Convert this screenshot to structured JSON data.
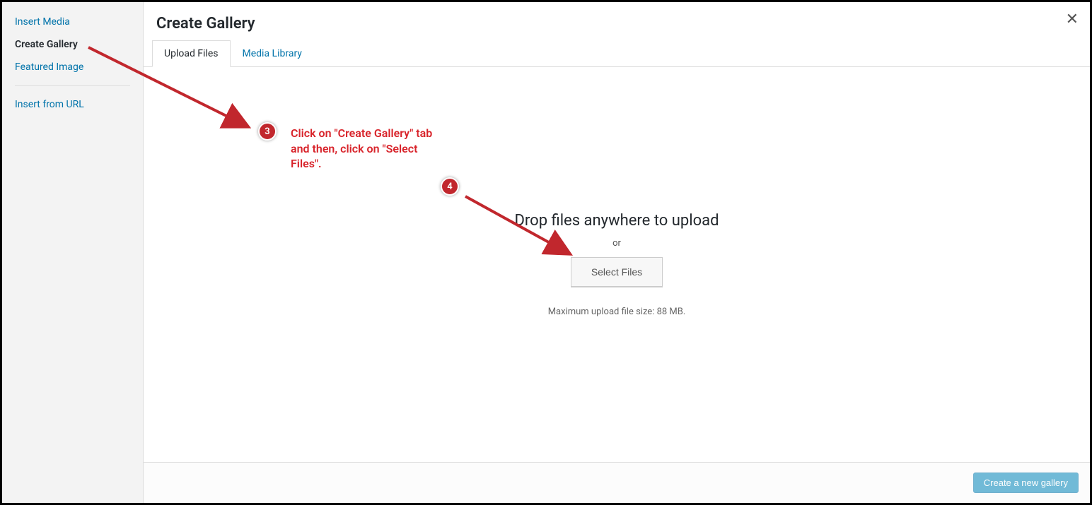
{
  "sidebar": {
    "items": [
      {
        "label": "Insert Media"
      },
      {
        "label": "Create Gallery"
      },
      {
        "label": "Featured Image"
      },
      {
        "label": "Insert from URL"
      }
    ]
  },
  "header": {
    "title": "Create Gallery"
  },
  "tabs": {
    "upload": "Upload Files",
    "library": "Media Library"
  },
  "drop": {
    "title": "Drop files anywhere to upload",
    "or": "or",
    "button": "Select Files",
    "max": "Maximum upload file size: 88 MB."
  },
  "footer": {
    "create": "Create a new gallery"
  },
  "annotations": {
    "badge3": "3",
    "badge4": "4",
    "text": "Click on  \"Create Gallery\" tab and then, click on \"Select Files\"."
  }
}
